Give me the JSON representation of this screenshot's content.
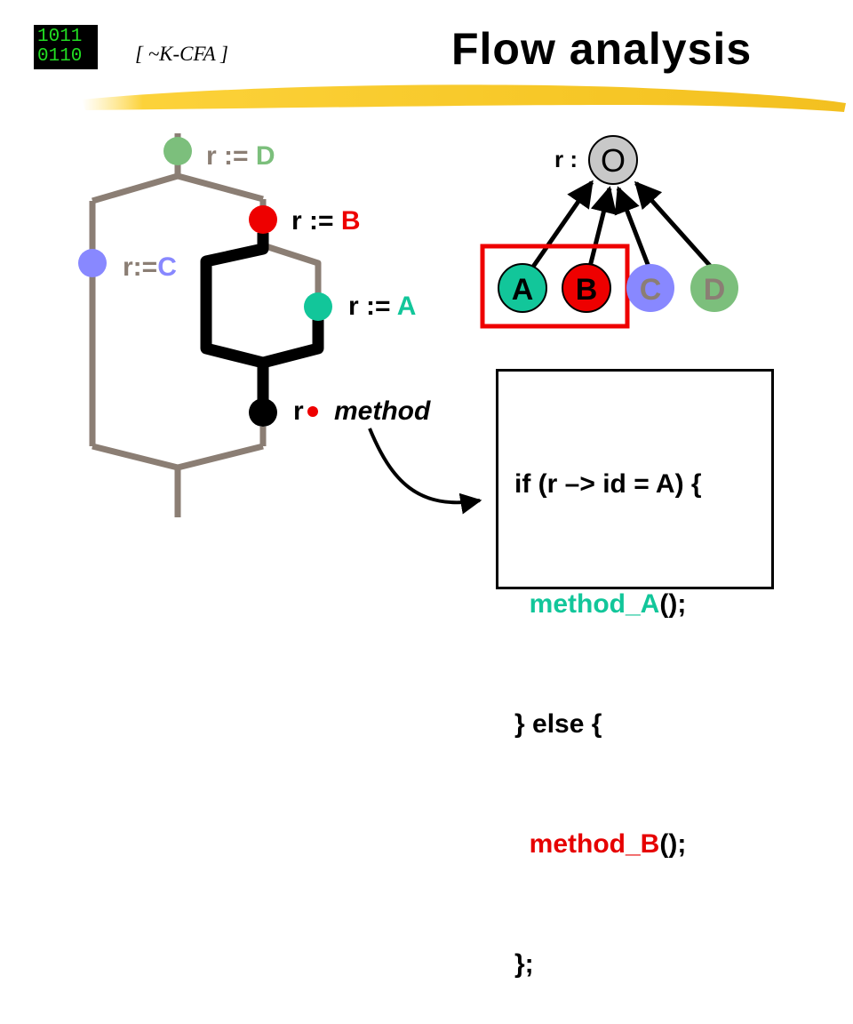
{
  "header": {
    "logo_line1": "1011",
    "logo_line2": "0110",
    "subtitle": "[ ~K-CFA ]",
    "title": "Flow analysis"
  },
  "colors": {
    "D": "#7cbf7c",
    "C": "#8888ff",
    "B": "#ee0000",
    "A": "#12c69a",
    "O": "#c8c8c8",
    "highlight": "#ee0000",
    "flow_path": "#8b7e74"
  },
  "flow_graph": {
    "assign_d": {
      "lhs": "r := ",
      "rhs": "D"
    },
    "assign_b": {
      "lhs": "r := ",
      "rhs": "B"
    },
    "assign_c": {
      "lhs": "r:=",
      "rhs": "C"
    },
    "assign_a": {
      "lhs": "r := ",
      "rhs": "A"
    },
    "call": {
      "receiver": "r",
      "method": "method"
    }
  },
  "type_hierarchy": {
    "var_label": "r :",
    "root": "O",
    "children": [
      "A",
      "B",
      "C",
      "D"
    ],
    "highlighted": [
      "A",
      "B"
    ]
  },
  "code": {
    "l1": "if (r –> id = A) {",
    "l2_name": "method_A",
    "l2_rest": "();",
    "l3": "} else {",
    "l4_name": "method_B",
    "l4_rest": "();",
    "l5": "};"
  }
}
